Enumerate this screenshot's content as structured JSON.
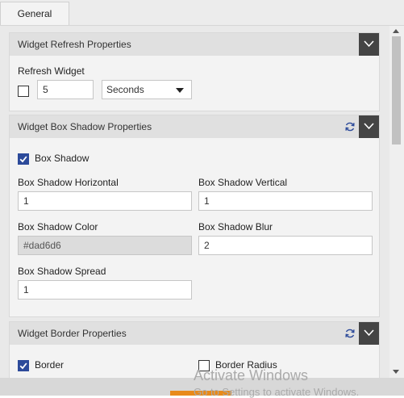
{
  "tabs": {
    "general": "General"
  },
  "refresh_panel": {
    "title": "Widget Refresh Properties",
    "refresh_label": "Refresh Widget",
    "refresh_checked": false,
    "interval_value": "5",
    "unit_value": "Seconds"
  },
  "shadow_panel": {
    "title": "Widget Box Shadow Properties",
    "box_shadow_label": "Box Shadow",
    "box_shadow_checked": true,
    "horizontal_label": "Box Shadow Horizontal",
    "horizontal_value": "1",
    "vertical_label": "Box Shadow Vertical",
    "vertical_value": "1",
    "color_label": "Box Shadow Color",
    "color_value": "#dad6d6",
    "blur_label": "Box Shadow Blur",
    "blur_value": "2",
    "spread_label": "Box Shadow Spread",
    "spread_value": "1"
  },
  "border_panel": {
    "title": "Widget Border Properties",
    "border_label": "Border",
    "border_checked": true,
    "radius_label": "Border Radius",
    "radius_checked": false
  },
  "watermark": {
    "line1": "Activate Windows",
    "line2": "Go to Settings to activate Windows."
  },
  "colors": {
    "accent": "#2c4a9a",
    "header_dark": "#444444",
    "refresh_icon": "#2c4a9a"
  },
  "icons": {
    "collapse": "chevron-down-icon",
    "refresh": "refresh-icon",
    "check": "check-icon"
  }
}
